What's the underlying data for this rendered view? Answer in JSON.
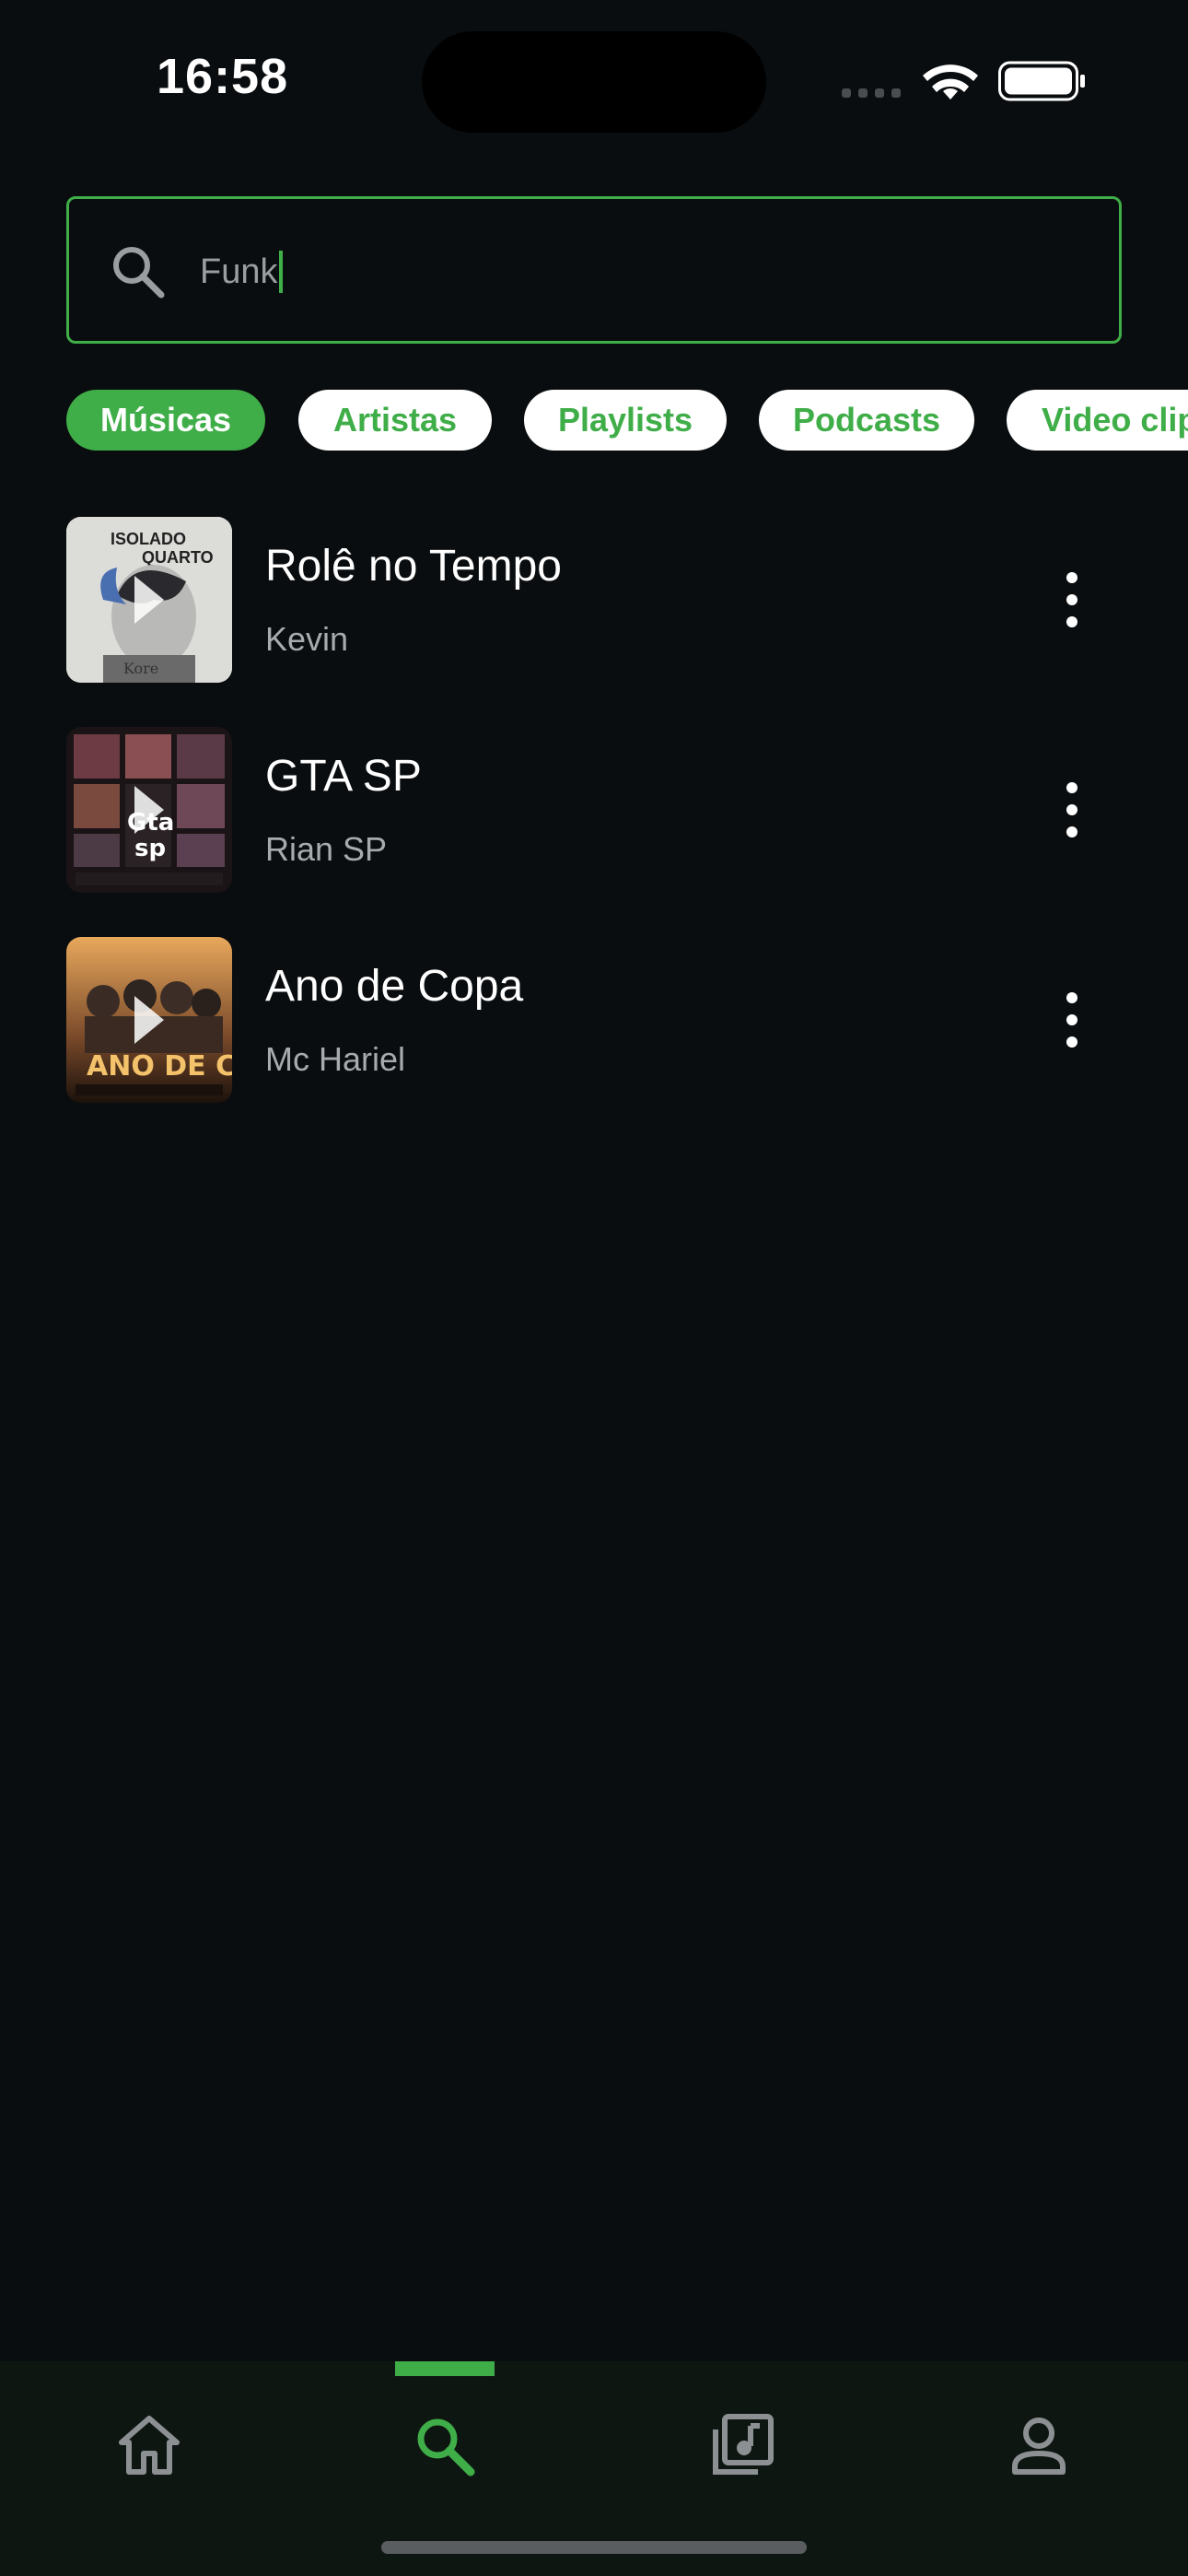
{
  "status_bar": {
    "time": "16:58"
  },
  "search": {
    "value": "Funk",
    "icon": "search-icon"
  },
  "filters": [
    {
      "label": "Músicas",
      "active": true
    },
    {
      "label": "Artistas",
      "active": false
    },
    {
      "label": "Playlists",
      "active": false
    },
    {
      "label": "Podcasts",
      "active": false
    },
    {
      "label": "Video clip",
      "active": false
    }
  ],
  "tracks": [
    {
      "title": "Rolê no Tempo",
      "artist": "Kevin"
    },
    {
      "title": "GTA SP",
      "artist": "Rian SP"
    },
    {
      "title": "Ano de Copa",
      "artist": "Mc Hariel"
    }
  ],
  "tab_bar": {
    "items": [
      {
        "icon": "home-icon",
        "active": false
      },
      {
        "icon": "search-icon",
        "active": true
      },
      {
        "icon": "music-library-icon",
        "active": false
      },
      {
        "icon": "profile-icon",
        "active": false
      }
    ]
  },
  "colors": {
    "accent": "#3fae48",
    "background": "#0a0d0f",
    "tab_bar": "#0e1612",
    "secondary_text": "#a8abad"
  }
}
